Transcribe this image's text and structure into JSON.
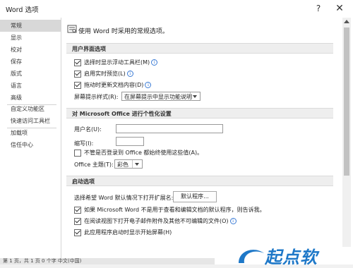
{
  "window": {
    "title": "Word 选项",
    "help_icon": "?",
    "close_icon": "✕"
  },
  "nav": {
    "items": [
      {
        "label": "常规",
        "active": true
      },
      {
        "label": "显示"
      },
      {
        "label": "校对"
      },
      {
        "label": "保存"
      },
      {
        "label": "版式"
      },
      {
        "label": "语言"
      },
      {
        "label": "高级"
      },
      {
        "label": "自定义功能区"
      },
      {
        "label": "快速访问工具栏"
      },
      {
        "label": "加载项"
      },
      {
        "label": "信任中心"
      }
    ]
  },
  "content": {
    "intro": "使用 Word 时采用的常规选项。",
    "ui_section": {
      "heading": "用户界面选项",
      "options": [
        {
          "label": "选择时显示浮动工具栏(M)",
          "checked": true,
          "info": true
        },
        {
          "label": "启用实时预览(L)",
          "checked": true,
          "info": true
        },
        {
          "label": "拖动时更新文档内容(D)",
          "checked": true,
          "info": true
        }
      ],
      "screentip_label": "屏幕提示样式(R):",
      "screentip_value": "在屏幕提示中显示功能说明"
    },
    "personalize_section": {
      "heading": "对 Microsoft Office 进行个性化设置",
      "username_label": "用户名(U):",
      "username_value": "",
      "initials_label": "缩写(I):",
      "initials_value": "",
      "always_use_label": "不管是否登录到 Office 都始终使用这些值(A)。",
      "always_use_checked": false,
      "theme_label": "Office 主题(T):",
      "theme_value": "彩色"
    },
    "startup_section": {
      "heading": "启动选项",
      "default_programs_label": "选择希望 Word 默认情况下打开扩展名:",
      "default_programs_button": "默认程序...",
      "options": [
        {
          "label": "如果 Microsoft Word 不是用于查看和编辑文档的默认程序，则告诉我。",
          "checked": true
        },
        {
          "label": "在阅读视图下打开电子邮件附件及其他不可编辑的文件(O)",
          "checked": true,
          "info": true
        },
        {
          "label": "此应用程序启动时显示开始屏幕(H)",
          "checked": true
        }
      ]
    }
  },
  "statusbar": {
    "text": "第 1 页，共 1 页    0 个字    中文(中国)"
  },
  "watermark": {
    "text": "起点软"
  },
  "colors": {
    "accent": "#1e78c8",
    "section_bg": "#eeeeee",
    "active_nav": "#d8d8d8"
  }
}
